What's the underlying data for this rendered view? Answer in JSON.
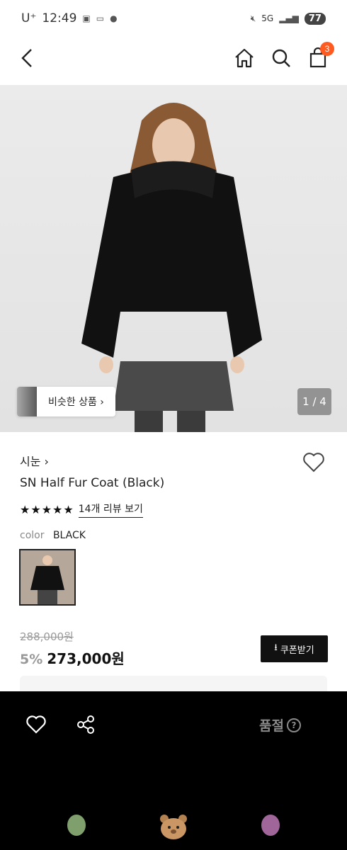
{
  "status": {
    "carrier": "U⁺",
    "time": "12:49",
    "network": "5G",
    "battery": "77"
  },
  "nav": {
    "cart_count": "3"
  },
  "gallery": {
    "similar_label": "비슷한 상품 ›",
    "page_indicator": "1 / 4"
  },
  "product": {
    "brand": "시눈 ›",
    "name": "SN Half Fur Coat (Black)",
    "stars": "★★★★★",
    "review_link": "14개 리뷰 보기",
    "color_label": "color",
    "color_value": "BLACK",
    "original_price": "288,000원",
    "discount": "5%",
    "sale_price": "273,000원",
    "coupon_label": "쿠폰받기"
  },
  "bottom": {
    "soldout_label": "품절",
    "help": "?"
  },
  "colors": {
    "accent": "#ff5a1f",
    "bottom_bg": "#000000",
    "coupon_bg": "#111111"
  }
}
